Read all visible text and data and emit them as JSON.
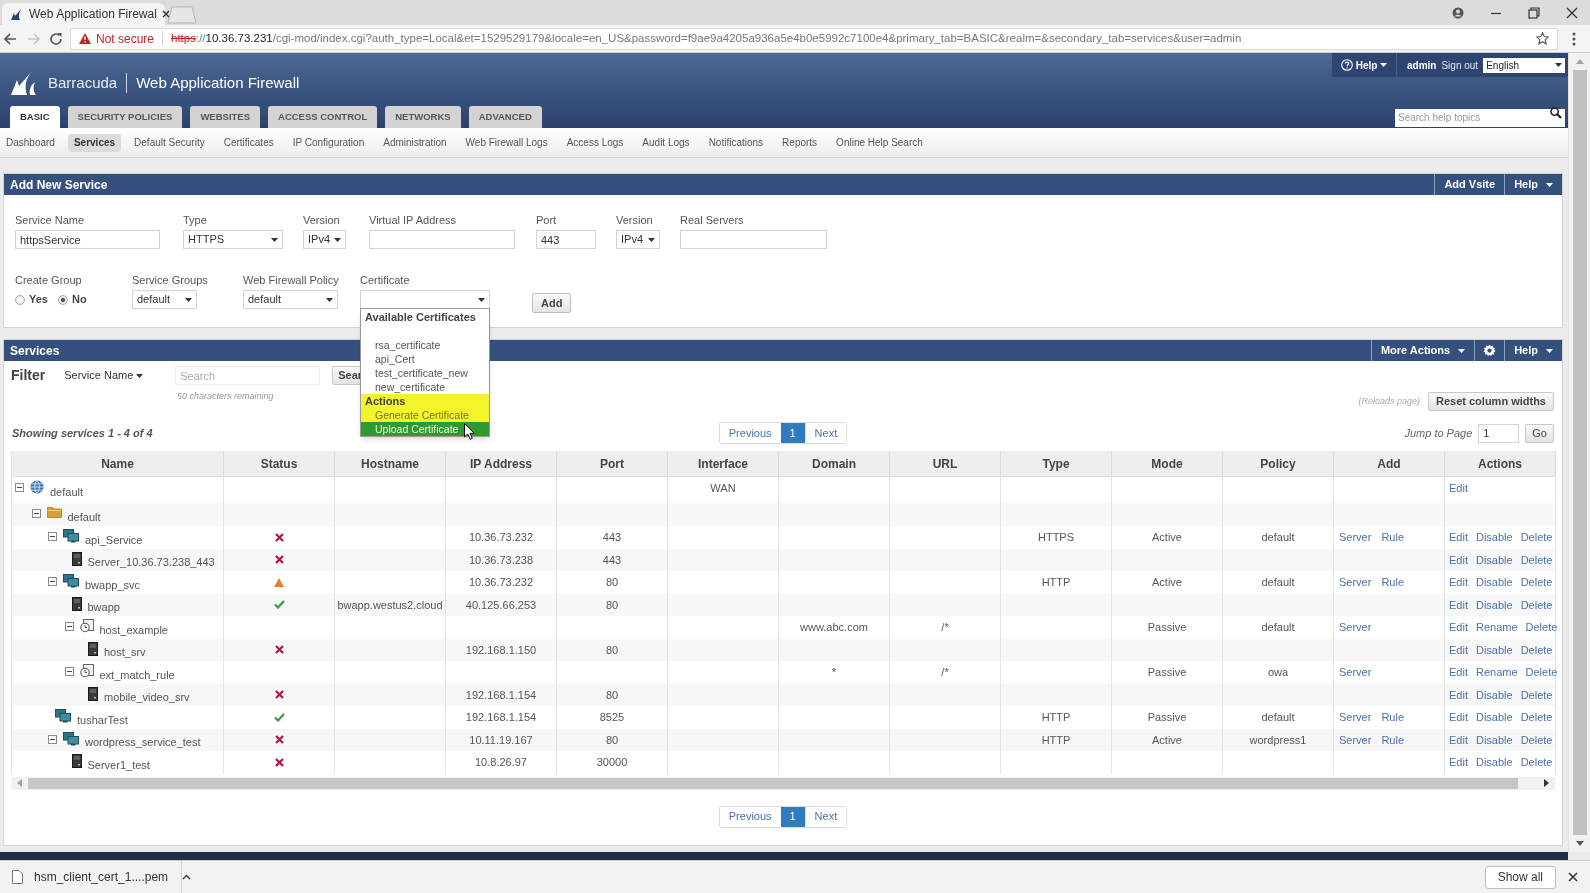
{
  "browser": {
    "tab": {
      "title": "Web Application Firewal"
    },
    "security": "Not secure",
    "url": [
      {
        "kind": "scheme",
        "text": "https"
      },
      {
        "kind": "plain",
        "text": "://"
      },
      {
        "kind": "host",
        "text": "10.36.73.231"
      },
      {
        "kind": "plain",
        "text": "/cgi-mod/index.cgi?auth_type=Local&et=1529529179&locale=en_US&password=f9ae9a4205a936a5e4b0e5992c7100e4&primary_tab=BASIC&realm=&secondary_tab=services&user=admin"
      }
    ]
  },
  "header": {
    "brand": "Barracuda",
    "product": "Web Application Firewall",
    "help": "Help",
    "user": "admin",
    "sign_out": "Sign out",
    "language": "English",
    "search": {
      "placeholder": "Search help topics"
    }
  },
  "primary_tabs": [
    {
      "label": "BASIC",
      "selected": true
    },
    {
      "label": "SECURITY POLICIES",
      "selected": false
    },
    {
      "label": "WEBSITES",
      "selected": false
    },
    {
      "label": "ACCESS CONTROL",
      "selected": false
    },
    {
      "label": "NETWORKS",
      "selected": false
    },
    {
      "label": "ADVANCED",
      "selected": false
    }
  ],
  "secondary_tabs": [
    {
      "label": "Dashboard",
      "selected": false
    },
    {
      "label": "Services",
      "selected": true
    },
    {
      "label": "Default Security",
      "selected": false
    },
    {
      "label": "Certificates",
      "selected": false
    },
    {
      "label": "IP Configuration",
      "selected": false
    },
    {
      "label": "Administration",
      "selected": false
    },
    {
      "label": "Web Firewall Logs",
      "selected": false
    },
    {
      "label": "Access Logs",
      "selected": false
    },
    {
      "label": "Audit Logs",
      "selected": false
    },
    {
      "label": "Notifications",
      "selected": false
    },
    {
      "label": "Reports",
      "selected": false
    },
    {
      "label": "Online Help Search",
      "selected": false
    }
  ],
  "add_service": {
    "title": "Add New Service",
    "buttons": [
      {
        "kind": "button",
        "label": "Add Vsite"
      },
      {
        "kind": "menu",
        "label": "Help"
      }
    ],
    "rows": [
      [
        {
          "label": "Service Name",
          "kind": "text",
          "value": "httpsService"
        },
        {
          "label": "Type",
          "kind": "select",
          "value": "HTTPS"
        },
        {
          "label": "Version",
          "kind": "select",
          "value": "IPv4"
        },
        {
          "label": "Virtual IP Address",
          "kind": "text"
        },
        {
          "label": "Port",
          "kind": "text",
          "value": "443"
        },
        {
          "label": "Version",
          "kind": "select",
          "value": "IPv4"
        },
        {
          "label": "Real Servers",
          "kind": "text"
        }
      ],
      [
        {
          "label": "Create Group",
          "kind": "radio",
          "options": [
            {
              "label": "Yes",
              "selected": false
            },
            {
              "label": "No",
              "selected": true
            }
          ]
        },
        {
          "label": "Service Groups",
          "kind": "select",
          "value": "default"
        },
        {
          "label": "Web Firewall Policy",
          "kind": "select",
          "value": "default"
        },
        {
          "label": "Certificate",
          "kind": "select",
          "expanded": true,
          "menu": {
            "groups": [
              {
                "kind": "certificates",
                "label": "Available Certificates",
                "options": [
                  {
                    "label": "rsa_certificate",
                    "selected": false
                  },
                  {
                    "label": "api_Cert",
                    "selected": false
                  },
                  {
                    "label": "test_certificate_new",
                    "selected": false
                  },
                  {
                    "label": "new_certificate",
                    "selected": false
                  }
                ]
              },
              {
                "kind": "actions",
                "label": "Actions",
                "options": [
                  {
                    "label": "Generate Certificate",
                    "selected": false
                  },
                  {
                    "label": "Upload Certificate",
                    "selected": true
                  }
                ]
              }
            ]
          }
        }
      ]
    ],
    "add_button": "Add"
  },
  "services": {
    "title": "Services",
    "buttons": [
      {
        "kind": "menu",
        "label": "More Actions"
      },
      {
        "kind": "settings"
      },
      {
        "kind": "menu",
        "label": "Help"
      }
    ],
    "filter": {
      "label": "Filter",
      "field": "Service Name",
      "search": {
        "placeholder": "Search"
      },
      "hint": "50 characters remaining",
      "button": "Sear"
    },
    "reload_note": "(Reloads page)",
    "reset_button": "Reset column widths",
    "summary": "Showing services 1 - 4 of 4",
    "pagination_top": {
      "previous": "Previous",
      "pages": [
        {
          "label": "1",
          "selected": true
        }
      ],
      "next": "Next"
    },
    "jump": {
      "label": "Jump to Page",
      "value": "1",
      "button": "Go"
    },
    "table": {
      "columns": [
        {
          "label": "Name"
        },
        {
          "label": "Status"
        },
        {
          "label": "Hostname"
        },
        {
          "label": "IP Address"
        },
        {
          "label": "Port"
        },
        {
          "label": "Interface"
        },
        {
          "label": "Domain"
        },
        {
          "label": "URL"
        },
        {
          "label": "Type"
        },
        {
          "label": "Mode"
        },
        {
          "label": "Policy"
        },
        {
          "label": "Add"
        },
        {
          "label": "Actions"
        }
      ],
      "rows": [
        {
          "kind": "vsite",
          "name": "default",
          "expanded": true,
          "interface": "WAN",
          "actions": [
            "Edit"
          ],
          "children": [
            {
              "kind": "group",
              "name": "default",
              "expanded": true,
              "children": [
                {
                  "kind": "service",
                  "name": "api_Service",
                  "expanded": true,
                  "status": {
                    "kind": "down"
                  },
                  "ip_address": "10.36.73.232",
                  "port": "443",
                  "type": "HTTPS",
                  "mode": "Active",
                  "policy": "default",
                  "add": [
                    "Server",
                    "Rule"
                  ],
                  "actions": [
                    "Edit",
                    "Disable",
                    "Delete"
                  ],
                  "children": [
                    {
                      "kind": "server",
                      "name": "Server_10.36.73.238_443",
                      "status": {
                        "kind": "down"
                      },
                      "ip_address": "10.36.73.238",
                      "port": "443",
                      "actions": [
                        "Edit",
                        "Disable",
                        "Delete"
                      ]
                    }
                  ]
                },
                {
                  "kind": "service",
                  "name": "bwapp_svc",
                  "expanded": true,
                  "status": {
                    "kind": "warning"
                  },
                  "ip_address": "10.36.73.232",
                  "port": "80",
                  "type": "HTTP",
                  "mode": "Active",
                  "policy": "default",
                  "add": [
                    "Server",
                    "Rule"
                  ],
                  "actions": [
                    "Edit",
                    "Disable",
                    "Delete"
                  ],
                  "children": [
                    {
                      "kind": "server",
                      "name": "bwapp",
                      "status": {
                        "kind": "up"
                      },
                      "hostname": "bwapp.westus2.cloud",
                      "ip_address": "40.125.66.253",
                      "port": "80",
                      "actions": [
                        "Edit",
                        "Disable",
                        "Delete"
                      ]
                    },
                    {
                      "kind": "rule",
                      "name": "host_example",
                      "expanded": true,
                      "domain": "www.abc.com",
                      "url": "/*",
                      "mode": "Passive",
                      "policy": "default",
                      "add": [
                        "Server"
                      ],
                      "actions": [
                        "Edit",
                        "Rename",
                        "Delete"
                      ],
                      "children": [
                        {
                          "kind": "server",
                          "name": "host_srv",
                          "status": {
                            "kind": "down"
                          },
                          "ip_address": "192.168.1.150",
                          "port": "80",
                          "actions": [
                            "Edit",
                            "Disable",
                            "Delete"
                          ]
                        }
                      ]
                    },
                    {
                      "kind": "rule",
                      "name": "ext_match_rule",
                      "expanded": true,
                      "domain": "*",
                      "url": "/*",
                      "mode": "Passive",
                      "policy": "owa",
                      "add": [
                        "Server"
                      ],
                      "actions": [
                        "Edit",
                        "Rename",
                        "Delete"
                      ],
                      "children": [
                        {
                          "kind": "server",
                          "name": "mobile_video_srv",
                          "status": {
                            "kind": "down"
                          },
                          "ip_address": "192.168.1.154",
                          "port": "80",
                          "actions": [
                            "Edit",
                            "Disable",
                            "Delete"
                          ]
                        }
                      ]
                    }
                  ]
                },
                {
                  "kind": "service",
                  "name": "tusharTest",
                  "status": {
                    "kind": "up"
                  },
                  "ip_address": "192.168.1.154",
                  "port": "8525",
                  "type": "HTTP",
                  "mode": "Passive",
                  "policy": "default",
                  "add": [
                    "Server",
                    "Rule"
                  ],
                  "actions": [
                    "Edit",
                    "Disable",
                    "Delete"
                  ]
                },
                {
                  "kind": "service",
                  "name": "wordpress_service_test",
                  "expanded": true,
                  "status": {
                    "kind": "down"
                  },
                  "ip_address": "10.11.19.167",
                  "port": "80",
                  "type": "HTTP",
                  "mode": "Active",
                  "policy": "wordpress1",
                  "add": [
                    "Server",
                    "Rule"
                  ],
                  "actions": [
                    "Edit",
                    "Disable",
                    "Delete"
                  ],
                  "children": [
                    {
                      "kind": "server",
                      "name": "Server1_test",
                      "status": {
                        "kind": "down"
                      },
                      "ip_address": "10.8.26.97",
                      "port": "30000",
                      "actions": [
                        "Edit",
                        "Disable",
                        "Delete"
                      ]
                    }
                  ]
                }
              ]
            }
          ]
        }
      ]
    },
    "pagination_bottom": {
      "previous": "Previous",
      "pages": [
        {
          "label": "1",
          "selected": true
        }
      ],
      "next": "Next"
    }
  },
  "download_bar": {
    "file": "hsm_client_cert_1....pem",
    "show_all": "Show all"
  }
}
